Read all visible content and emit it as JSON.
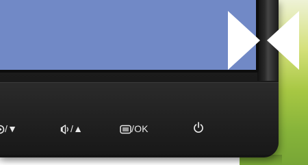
{
  "monitor": {
    "buttons": [
      {
        "icon": "input-select-icon",
        "label": "/▼"
      },
      {
        "icon": "speaker-icon",
        "label": "/▲"
      },
      {
        "icon": "menu-icon",
        "label": "/OK"
      },
      {
        "icon": "power-icon",
        "label": ""
      }
    ]
  },
  "colors": {
    "screen": "#7189c6",
    "bezel": "#1d1d1d",
    "wall_green": "#86b33a",
    "arrow": "#ffffff"
  }
}
